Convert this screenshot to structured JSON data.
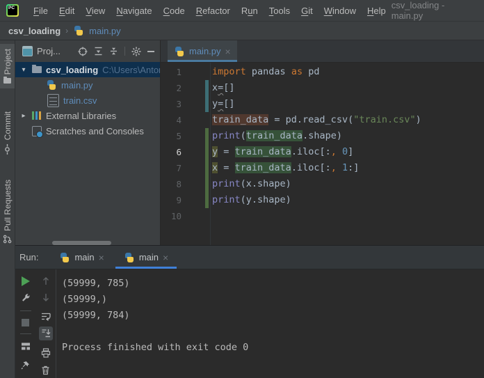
{
  "window": {
    "title": "csv_loading - main.py",
    "logo_text": "PC"
  },
  "menu": {
    "items": [
      {
        "label": "File",
        "mnemonic": "F"
      },
      {
        "label": "Edit",
        "mnemonic": "E"
      },
      {
        "label": "View",
        "mnemonic": "V"
      },
      {
        "label": "Navigate",
        "mnemonic": "N"
      },
      {
        "label": "Code",
        "mnemonic": "C"
      },
      {
        "label": "Refactor",
        "mnemonic": "R"
      },
      {
        "label": "Run",
        "mnemonic": "u"
      },
      {
        "label": "Tools",
        "mnemonic": "T"
      },
      {
        "label": "Git",
        "mnemonic": "G"
      },
      {
        "label": "Window",
        "mnemonic": "W"
      },
      {
        "label": "Help",
        "mnemonic": "H"
      }
    ]
  },
  "breadcrumb": {
    "project": "csv_loading",
    "separator": "›",
    "file": "main.py"
  },
  "stripe": {
    "project": "Project",
    "commit": "Commit",
    "pull_requests": "Pull Requests"
  },
  "project_panel": {
    "tab_label": "Proj...",
    "tree": {
      "root_expanded_glyph": "▾",
      "collapsed_glyph": "▸",
      "root_name": "csv_loading",
      "root_path": "C:\\Users\\Antony G",
      "file1": "main.py",
      "file2": "train.csv",
      "node1": "External Libraries",
      "node2": "Scratches and Consoles"
    }
  },
  "editor": {
    "tab": {
      "label": "main.py",
      "close": "×"
    },
    "gutter_bars": [
      {
        "from": 2,
        "to": 3,
        "type": "modified"
      },
      {
        "from": 5,
        "to": 9,
        "type": "added"
      }
    ],
    "lines": [
      {
        "num": "1",
        "tokens": [
          {
            "t": "import",
            "c": "kw"
          },
          {
            "t": " pandas ",
            "c": "d"
          },
          {
            "t": "as",
            "c": "kw"
          },
          {
            "t": " pd",
            "c": "d"
          }
        ]
      },
      {
        "num": "2",
        "tokens": [
          {
            "t": "x",
            "c": "d"
          },
          {
            "t": "=",
            "c": "wv"
          },
          {
            "t": "[]",
            "c": "d"
          }
        ]
      },
      {
        "num": "3",
        "tokens": [
          {
            "t": "y",
            "c": "d"
          },
          {
            "t": "=",
            "c": "wv"
          },
          {
            "t": "[]",
            "c": "d"
          }
        ]
      },
      {
        "num": "4",
        "tokens": [
          {
            "t": "train_data",
            "c": "hlw"
          },
          {
            "t": " = pd.read_csv(",
            "c": "d"
          },
          {
            "t": "\"train.csv\"",
            "c": "str"
          },
          {
            "t": ")",
            "c": "d"
          }
        ]
      },
      {
        "num": "5",
        "tokens": [
          {
            "t": "print",
            "c": "bi"
          },
          {
            "t": "(",
            "c": "d"
          },
          {
            "t": "train_data",
            "c": "hlr"
          },
          {
            "t": ".shape)",
            "c": "d"
          }
        ]
      },
      {
        "num": "6",
        "current": true,
        "tokens": [
          {
            "t": "y",
            "c": "hlv"
          },
          {
            "t": " = ",
            "c": "d"
          },
          {
            "t": "train_data",
            "c": "hlr"
          },
          {
            "t": ".iloc[:",
            "c": "d"
          },
          {
            "t": ",",
            "c": "cm"
          },
          {
            "t": " ",
            "c": "d"
          },
          {
            "t": "0",
            "c": "num"
          },
          {
            "t": "]",
            "c": "d"
          }
        ]
      },
      {
        "num": "7",
        "tokens": [
          {
            "t": "x",
            "c": "hlv"
          },
          {
            "t": " = ",
            "c": "d"
          },
          {
            "t": "train_data",
            "c": "hlr"
          },
          {
            "t": ".iloc[:",
            "c": "d"
          },
          {
            "t": ",",
            "c": "cm"
          },
          {
            "t": " ",
            "c": "d"
          },
          {
            "t": "1",
            "c": "num"
          },
          {
            "t": ":]",
            "c": "d"
          }
        ]
      },
      {
        "num": "8",
        "tokens": [
          {
            "t": "print",
            "c": "bi"
          },
          {
            "t": "(x.shape)",
            "c": "d"
          }
        ]
      },
      {
        "num": "9",
        "tokens": [
          {
            "t": "print",
            "c": "bi"
          },
          {
            "t": "(y.shape)",
            "c": "d"
          }
        ]
      },
      {
        "num": "10",
        "tokens": []
      }
    ]
  },
  "run_panel": {
    "label": "Run:",
    "tab_close": "×",
    "tabs": [
      {
        "label": "main",
        "selected": false
      },
      {
        "label": "main",
        "selected": true
      }
    ],
    "console_lines": [
      "(59999, 785)",
      "(59999,)",
      "(59999, 784)",
      "",
      "Process finished with exit code 0"
    ]
  },
  "colors": {
    "panel_bg": "#3C3F41",
    "editor_bg": "#2B2B2B",
    "selection_row": "#0E2F4D",
    "modified_file_blue": "#5F8CBA",
    "keyword_orange": "#CC7832",
    "string_green": "#6A8759",
    "number_blue": "#6897BB",
    "builtin_purple": "#8888C6",
    "run_tab_underline": "#3F80D8",
    "editor_tab_underline": "#4A7A9F",
    "gutter_added_green": "#4D6B40",
    "gutter_modified_teal": "#3D6E75",
    "play_green": "#4DA156"
  },
  "icons": {
    "tree_expanded": "▾",
    "tree_collapsed": "▸",
    "breadcrumb_chevron": "›"
  }
}
